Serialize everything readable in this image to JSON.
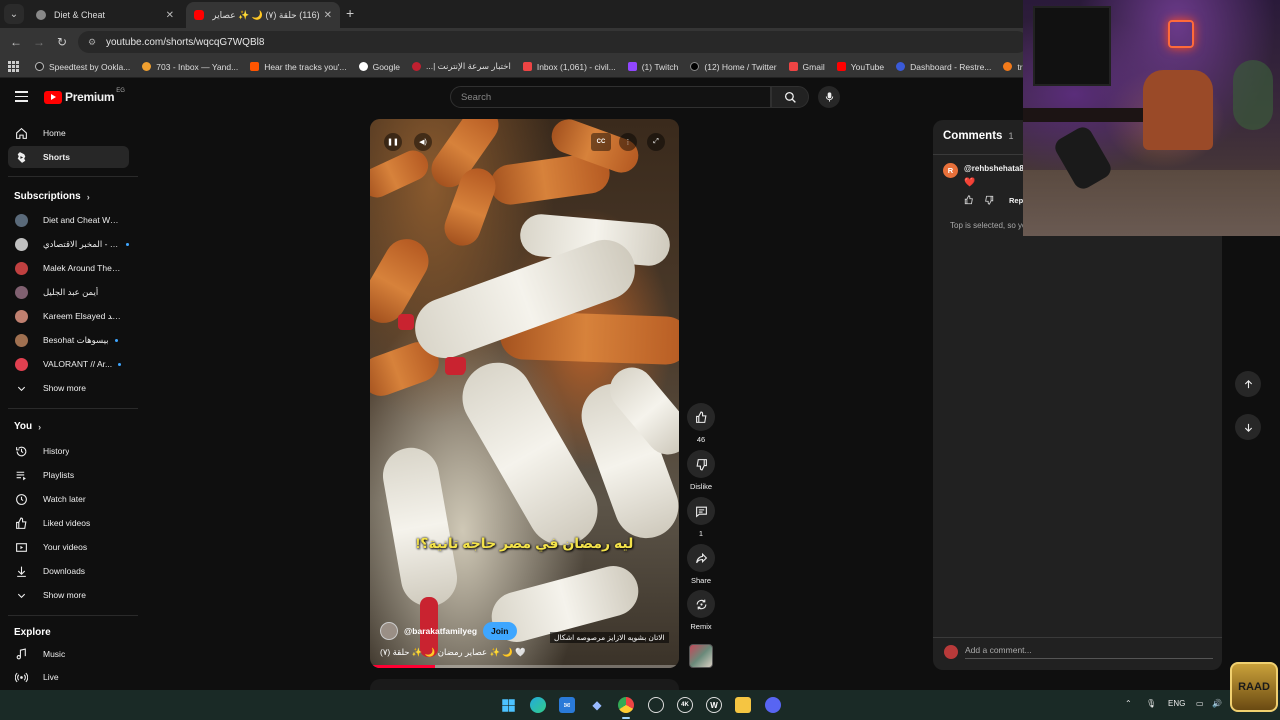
{
  "browser": {
    "tabs": [
      {
        "title": "Diet & Cheat",
        "active": false
      },
      {
        "title": "(116) حلقة (٧) 🌙 ✨ عصاير رمضـ",
        "active": true
      }
    ],
    "url": "youtube.com/shorts/wqcqG7WQBl8",
    "bookmarks": [
      "Speedtest by Ookla...",
      "703 - Inbox — Yand...",
      "Hear the tracks you'...",
      "Google",
      "اختبار سرعة الإنترنت |...",
      "Inbox (1,061) - civil...",
      "(1) Twitch",
      "(12) Home / Twitter",
      "Gmail",
      "YouTube",
      "Dashboard - Restre...",
      "trendyol"
    ]
  },
  "header": {
    "logo_text": "Premium",
    "country_code": "EG",
    "search_placeholder": "Search"
  },
  "sidebar": {
    "main": [
      {
        "label": "Home",
        "icon": "home-icon"
      },
      {
        "label": "Shorts",
        "icon": "shorts-icon",
        "selected": true
      }
    ],
    "subscriptions_title": "Subscriptions",
    "subscriptions": [
      {
        "label": "Diet and Cheat Wor...",
        "live": false,
        "color": "#5a6a7a"
      },
      {
        "label": "المخبر الاقتصادي - M...",
        "live": true,
        "color": "#c0c0c0"
      },
      {
        "label": "Malek Around The ...",
        "live": false,
        "color": "#c04040"
      },
      {
        "label": "أيمن عبد الجليل",
        "live": false,
        "color": "#806070"
      },
      {
        "label": "Kareem Elsayed كريم السيد",
        "live": false,
        "color": "#c08070"
      },
      {
        "label": "Besohat بيسوهات",
        "live": true,
        "color": "#a07050"
      },
      {
        "label": "VALORANT // Ar...",
        "live": true,
        "color": "#e04050"
      }
    ],
    "show_more": "Show more",
    "you_title": "You",
    "you_items": [
      {
        "label": "History",
        "icon": "history-icon"
      },
      {
        "label": "Playlists",
        "icon": "playlists-icon"
      },
      {
        "label": "Watch later",
        "icon": "watch-later-icon"
      },
      {
        "label": "Liked videos",
        "icon": "liked-videos-icon"
      },
      {
        "label": "Your videos",
        "icon": "your-videos-icon"
      },
      {
        "label": "Downloads",
        "icon": "downloads-icon"
      },
      {
        "label": "Show more",
        "icon": "chevron-down-icon"
      }
    ],
    "explore_title": "Explore",
    "explore_items": [
      {
        "label": "Music",
        "icon": "music-icon"
      },
      {
        "label": "Live",
        "icon": "live-icon"
      }
    ]
  },
  "short": {
    "caption": "ليه رمضان في مصر حاجه تانية؟!",
    "channel": "@barakatfamilyeg",
    "join_label": "Join",
    "sound": "الاتان بشويه الازايز مرصوصه اشكال",
    "title": "🤍 🌙 ✨ عصاير رمضان 🌙 ✨ حلقة (٧)",
    "progress": 0.21,
    "cc_label": "CC"
  },
  "actions": {
    "like_count": "46",
    "dislike_label": "Dislike",
    "comment_count": "1",
    "share_label": "Share",
    "remix_label": "Remix"
  },
  "comments": {
    "title": "Comments",
    "count": "1",
    "items": [
      {
        "user": "@rehbshehata87",
        "avatar_letter": "R",
        "text": "❤️"
      }
    ],
    "reply_label": "Reply",
    "note": "Top is selected, so you'll see featured comments",
    "add_placeholder": "Add a comment..."
  },
  "taskbar": {
    "language": "ENG",
    "badge_text": "RAAD"
  }
}
